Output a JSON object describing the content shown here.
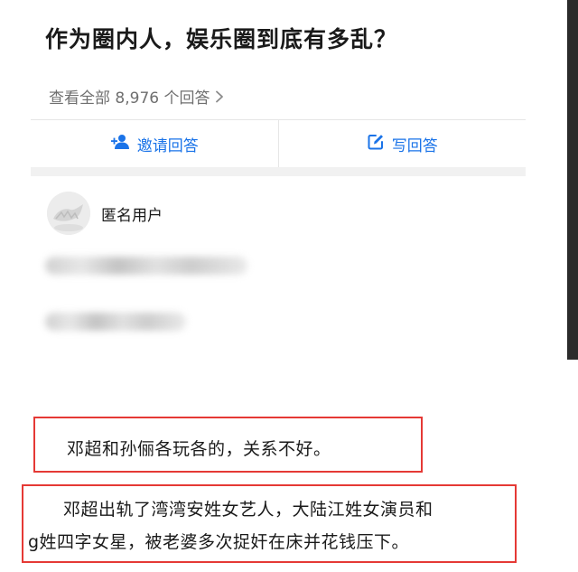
{
  "question": {
    "title": "作为圈内人，娱乐圈到底有多乱？",
    "view_all": "查看全部 8,976 个回答"
  },
  "actions": {
    "invite_label": "邀请回答",
    "write_label": "写回答",
    "accent_color": "#1a73e8"
  },
  "answer": {
    "author_name": "匿名用户",
    "highlight_1": "邓超和孙俪各玩各的，关系不好。",
    "highlight_2_line_1": "邓超出轨了湾湾安姓女艺人，大陆江姓女演员和",
    "highlight_2_line_2": "g姓四字女星，被老婆多次捉奸在床并花钱压下。",
    "highlight_border_color": "#e53935"
  },
  "icons": {
    "chevron": "chevron-right-icon",
    "invite": "add-person-icon",
    "write": "edit-icon"
  }
}
